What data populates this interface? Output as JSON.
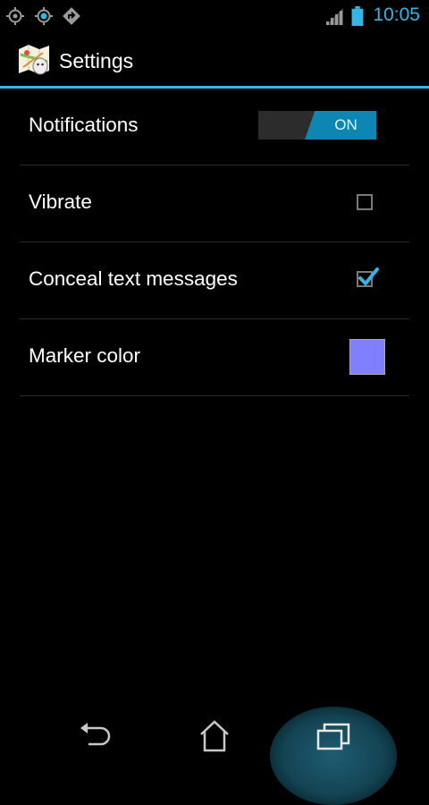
{
  "status_bar": {
    "icons": [
      "location-icon",
      "gps-icon",
      "navigation-icon",
      "signal-icon",
      "battery-icon"
    ],
    "time": "10:05",
    "accent_color": "#33b5e5"
  },
  "action_bar": {
    "app_icon": "maps-app-icon",
    "title": "Settings"
  },
  "preferences": [
    {
      "label": "Notifications",
      "control": "toggle",
      "value": "ON",
      "checked": true
    },
    {
      "label": "Vibrate",
      "control": "checkbox",
      "checked": false
    },
    {
      "label": "Conceal text messages",
      "control": "checkbox",
      "checked": true
    },
    {
      "label": "Marker color",
      "control": "color-swatch",
      "color": "#8080ff"
    }
  ],
  "nav_bar": {
    "buttons": [
      "back-icon",
      "home-icon",
      "recents-icon"
    ],
    "active": "recents-icon"
  }
}
